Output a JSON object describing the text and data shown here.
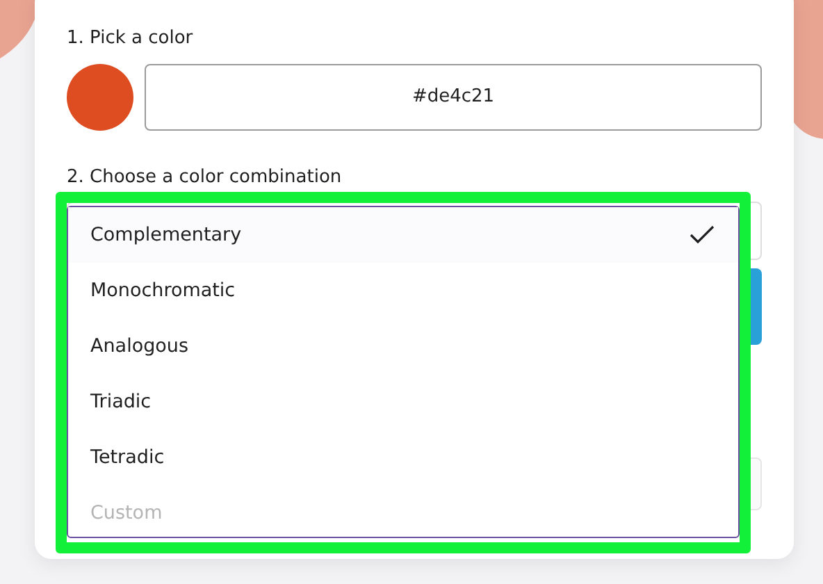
{
  "step_1": {
    "label": "1. Pick a color",
    "swatch": {
      "color": "#de4c21"
    },
    "hex_field": {
      "value": "#de4c21"
    }
  },
  "step_2": {
    "label": "2. Choose a color combination",
    "dropdown": {
      "highlighted": true,
      "options": [
        {
          "label": "Complementary",
          "selected": true,
          "disabled": false
        },
        {
          "label": "Monochromatic",
          "selected": false,
          "disabled": false
        },
        {
          "label": "Analogous",
          "selected": false,
          "disabled": false
        },
        {
          "label": "Triadic",
          "selected": false,
          "disabled": false
        },
        {
          "label": "Tetradic",
          "selected": false,
          "disabled": false
        },
        {
          "label": "Custom",
          "selected": false,
          "disabled": true
        }
      ]
    }
  }
}
